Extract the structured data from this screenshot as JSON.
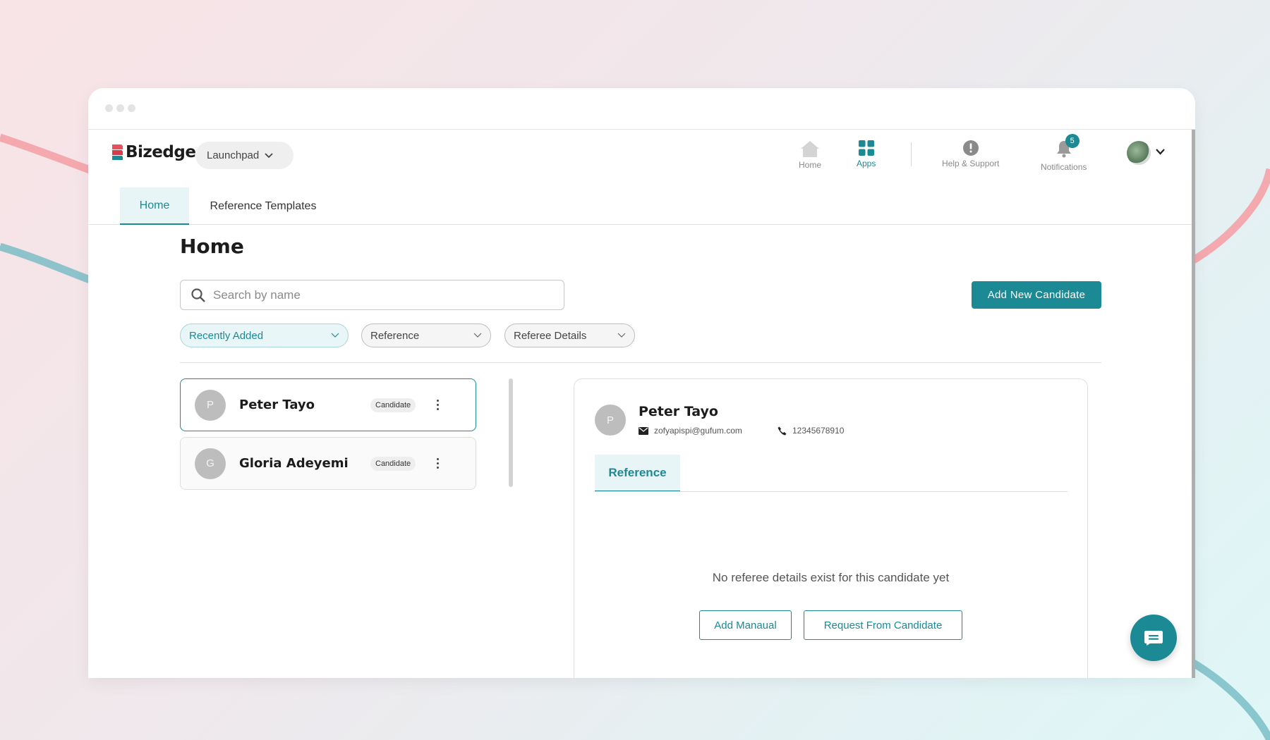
{
  "window": {
    "dots": 3
  },
  "brand": {
    "name": "Bizedge",
    "launchpad_label": "Launchpad"
  },
  "topnav": {
    "home_label": "Home",
    "apps_label": "Apps",
    "help_label": "Help & Support",
    "notifications_label": "Notifications",
    "notifications_count": "5"
  },
  "tabs": [
    {
      "label": "Home",
      "active": true
    },
    {
      "label": "Reference Templates",
      "active": false
    }
  ],
  "page": {
    "title": "Home",
    "search_placeholder": "Search by name",
    "add_button": "Add New Candidate"
  },
  "filters": [
    {
      "label": "Recently Added",
      "active": true
    },
    {
      "label": "Reference",
      "active": false
    },
    {
      "label": "Referee Details",
      "active": false
    }
  ],
  "candidates": [
    {
      "initial": "P",
      "name": "Peter Tayo",
      "tag": "Candidate",
      "selected": true
    },
    {
      "initial": "G",
      "name": "Gloria Adeyemi",
      "tag": "Candidate",
      "selected": false
    }
  ],
  "detail": {
    "initial": "P",
    "name": "Peter Tayo",
    "email": "zofyapispi@gufum.com",
    "phone": "12345678910",
    "tab_label": "Reference",
    "empty_message": "No referee details exist for this candidate yet",
    "add_manual_label": "Add Manaual",
    "request_label": "Request From Candidate"
  },
  "colors": {
    "accent": "#1b8a95",
    "brand_red": "#e8505b"
  }
}
